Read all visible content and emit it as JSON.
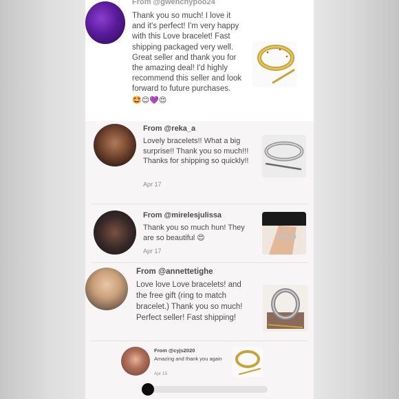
{
  "reviews": [
    {
      "from": "From @gwenchypoo24",
      "text": "Thank you so much! I love it and it's perfect! I'm very happy with this Love bracelet! Fast shipping packaged very well. Great seller and thank you for the amazing deal! I'd highly recommend this seller and look forward to future purchases.",
      "emojis": "🤩😊💜😍",
      "date": ""
    },
    {
      "from": "From @reka_a",
      "text": "Lovely bracelets!! What a big surprise!! Thank you so much!!! Thanks for shipping so quickly!!",
      "date": "Apr 17"
    },
    {
      "from": "From @mirelesjulissa",
      "text": "Thank you so much hun! They are so beautiful",
      "emojis": "😍",
      "date": "Apr 17"
    },
    {
      "from": "From @annettetighe",
      "text": "Love love Love bracelets! and the free gift (ring to match bracelet.) Thank you so much! Perfect seller! Fast shipping!",
      "date": ""
    },
    {
      "from": "From @cyjs2020",
      "text": "Amazing and thank you again",
      "date": "Apr 15"
    }
  ],
  "icons": {
    "r1_thumb": "gold-bangle-with-screwdriver-photo",
    "r2_thumb": "silver-bangle-with-screwdriver-photo",
    "r3_thumb": "bracelet-on-wrist-photo",
    "r4_thumb": "silver-bangle-on-box-photo",
    "r5_thumb": "gold-bangle-photo"
  },
  "colors": {
    "text": "#4a4a4a",
    "date": "#8c8c8c",
    "gold": "#c9a332",
    "scrub_handle": "#0d0d0d"
  }
}
